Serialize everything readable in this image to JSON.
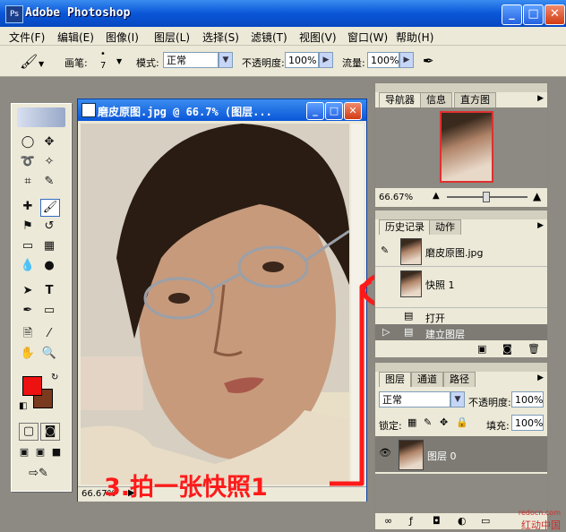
{
  "app": {
    "title": "Adobe Photoshop",
    "logo": "Ps"
  },
  "window_controls": {
    "minimize": "_",
    "maximize": "□",
    "close": "✕"
  },
  "menus": [
    "文件(F)",
    "编辑(E)",
    "图像(I)",
    "图层(L)",
    "选择(S)",
    "滤镜(T)",
    "视图(V)",
    "窗口(W)",
    "帮助(H)"
  ],
  "options": {
    "brush_label": "画笔:",
    "brush_size": "7",
    "mode_label": "模式:",
    "mode_value": "正常",
    "opacity_label": "不透明度:",
    "opacity_value": "100%",
    "flow_label": "流量:",
    "flow_value": "100%"
  },
  "document": {
    "title": "磨皮原图.jpg @ 66.7% (图层...",
    "zoom": "66.67%"
  },
  "navigator": {
    "tabs": [
      "导航器",
      "信息",
      "直方图"
    ],
    "zoom": "66.67%"
  },
  "history": {
    "tabs": [
      "历史记录",
      "动作"
    ],
    "items": [
      "磨皮原图.jpg",
      "快照 1",
      "打开",
      "建立图层"
    ]
  },
  "layers": {
    "tabs": [
      "图层",
      "通道",
      "路径"
    ],
    "mode_value": "正常",
    "opacity_label": "不透明度:",
    "opacity_value": "100%",
    "lock_label": "锁定:",
    "fill_label": "填充:",
    "fill_value": "100%",
    "items": [
      "图层 0"
    ]
  },
  "annotation": {
    "text": "3.拍一张快照1",
    "color": "#ff1a1a"
  },
  "watermark": {
    "site": "redocn.com",
    "brand": "红动中国"
  },
  "colors": {
    "foreground": "#ee1111",
    "background": "#7a3a1e",
    "title_blue": "#0a56d8"
  }
}
